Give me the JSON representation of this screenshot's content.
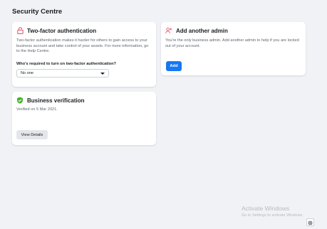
{
  "page": {
    "title": "Security Centre"
  },
  "two_factor": {
    "title": "Two-factor authentication",
    "icon": "lock-icon",
    "description": "Two-factor authentication makes it harder for others to gain access to your business account and take control of your assets. For more information, go to the Help Centre.",
    "question": "Who's required to turn on two-factor authentication?",
    "selected_option": "No one"
  },
  "admin": {
    "title": "Add another admin",
    "icon": "add-user-icon",
    "description": "You're the only business admin. Add another admin to help if you are locked out of your account.",
    "button_label": "Add"
  },
  "business_verification": {
    "title": "Business verification",
    "icon": "verified-shield-icon",
    "status": "Verified on 5 Mar 2021.",
    "button_label": "View Details"
  },
  "watermark": {
    "title": "Activate Windows",
    "subtitle": "Go to Settings to activate Windows."
  },
  "colors": {
    "accent": "#1877f2",
    "warning": "#e4495f",
    "verified": "#42b72a",
    "background": "#f0f2f5"
  }
}
